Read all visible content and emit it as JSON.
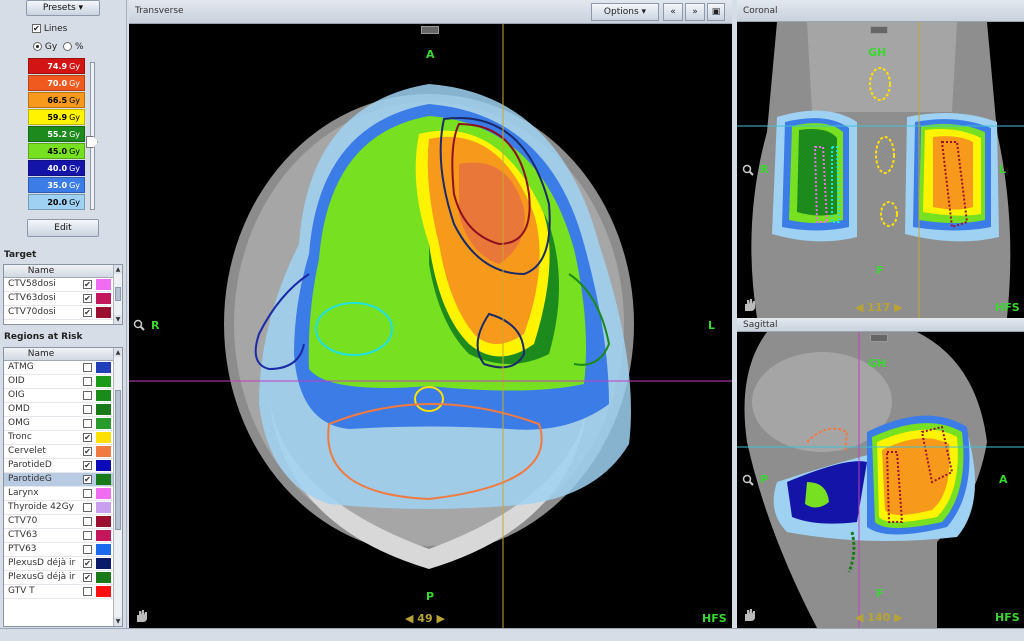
{
  "left_panel": {
    "presets_label": "Presets",
    "lines_label": "Lines",
    "lines_checked": true,
    "unit_gy": "Gy",
    "unit_percent": "%",
    "dose_levels": [
      {
        "label": "74.9",
        "unit": "Gy",
        "color": "#d21414",
        "text": "#fff"
      },
      {
        "label": "70.0",
        "unit": "Gy",
        "color": "#f05a1e",
        "text": "#fff"
      },
      {
        "label": "66.5",
        "unit": "Gy",
        "color": "#f79a1c",
        "text": "#000"
      },
      {
        "label": "59.9",
        "unit": "Gy",
        "color": "#fff300",
        "text": "#000"
      },
      {
        "label": "55.2",
        "unit": "Gy",
        "color": "#1d8a1d",
        "text": "#fff"
      },
      {
        "label": "45.0",
        "unit": "Gy",
        "color": "#77e021",
        "text": "#000"
      },
      {
        "label": "40.0",
        "unit": "Gy",
        "color": "#1414a8",
        "text": "#fff"
      },
      {
        "label": "35.0",
        "unit": "Gy",
        "color": "#3c7ce6",
        "text": "#fff"
      },
      {
        "label": "20.0",
        "unit": "Gy",
        "color": "#9fd2f2",
        "text": "#000"
      }
    ],
    "edit_label": "Edit",
    "target_title": "Target",
    "target_header": "Name",
    "targets": [
      {
        "name": "CTV58dosi",
        "checked": true,
        "color": "#f06cf0"
      },
      {
        "name": "CTV63dosi",
        "checked": true,
        "color": "#c2185b"
      },
      {
        "name": "CTV70dosi",
        "checked": true,
        "color": "#9b1030"
      }
    ],
    "risk_title": "Regions at Risk",
    "risk_header": "Name",
    "regions": [
      {
        "name": "ATMG",
        "checked": false,
        "color": "#1f3fb8"
      },
      {
        "name": "OID",
        "checked": false,
        "color": "#1a9a1a"
      },
      {
        "name": "OIG",
        "checked": false,
        "color": "#1a8a1a"
      },
      {
        "name": "OMD",
        "checked": false,
        "color": "#1a7a1a"
      },
      {
        "name": "OMG",
        "checked": false,
        "color": "#2a9a2a"
      },
      {
        "name": "Tronc",
        "checked": true,
        "color": "#ffe000"
      },
      {
        "name": "Cervelet",
        "checked": true,
        "color": "#f07a40"
      },
      {
        "name": "ParotideD",
        "checked": true,
        "color": "#0a0ab8"
      },
      {
        "name": "ParotideG",
        "checked": true,
        "color": "#1a7a1a",
        "selected": true
      },
      {
        "name": "Larynx",
        "checked": false,
        "color": "#f06cf0"
      },
      {
        "name": "Thyroide 42Gy",
        "checked": false,
        "color": "#c9a0f0"
      },
      {
        "name": "CTV70",
        "checked": false,
        "color": "#9b1030"
      },
      {
        "name": "CTV63",
        "checked": false,
        "color": "#c2185b"
      },
      {
        "name": "PTV63",
        "checked": false,
        "color": "#1a6aee"
      },
      {
        "name": "PlexusD déjà ir",
        "checked": true,
        "color": "#0a1a6a"
      },
      {
        "name": "PlexusG déjà ir",
        "checked": true,
        "color": "#1a7a1a"
      },
      {
        "name": "GTV T",
        "checked": false,
        "color": "#ff1010"
      }
    ]
  },
  "transverse": {
    "title": "Transverse",
    "options_label": "Options",
    "label_top": "A",
    "label_bottom": "P",
    "label_left": "R",
    "label_right": "L",
    "orientation": "HFS",
    "slice_number": "49"
  },
  "coronal": {
    "title": "Coronal",
    "label_top": "GH",
    "label_bottom": "F",
    "label_left": "R",
    "label_right": "L",
    "orientation": "HFS",
    "slice_number": "117"
  },
  "sagittal": {
    "title": "Sagittal",
    "label_top": "GH",
    "label_bottom": "F",
    "label_left": "P",
    "label_right": "A",
    "orientation": "HFS",
    "slice_number": "140"
  },
  "colors": {
    "crosshair_vertical": "#c8a830",
    "crosshair_horizontal": "#c040c0",
    "orientation_label": "#38d82f"
  }
}
